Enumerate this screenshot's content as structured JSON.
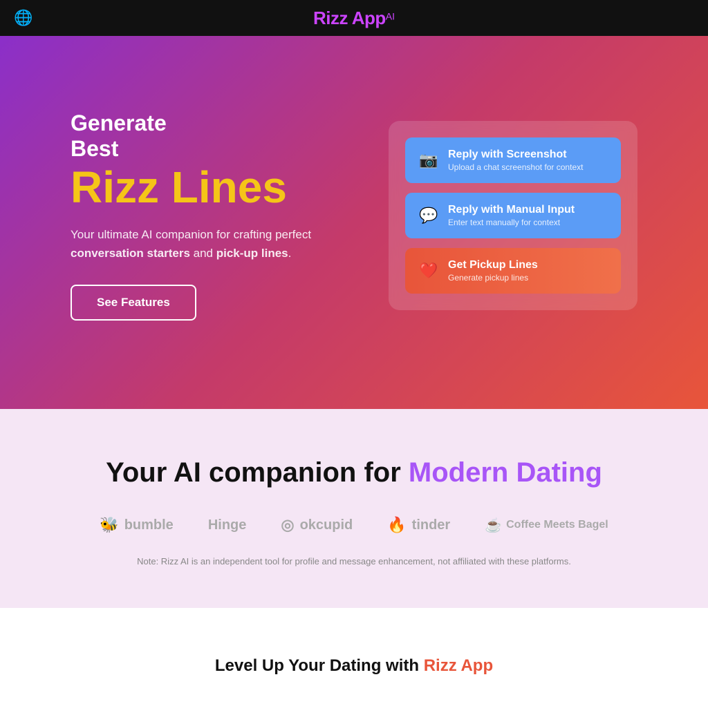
{
  "nav": {
    "title": "Rizz App",
    "title_ai": "AI",
    "globe_icon": "🌐"
  },
  "hero": {
    "headline_line1": "Generate",
    "headline_line2": "Best",
    "headline_rizz": "Rizz Lines",
    "subtext_normal": "Your ultimate AI companion for crafting perfect ",
    "subtext_bold1": "conversation starters",
    "subtext_and": " and ",
    "subtext_bold2": "pick-up lines",
    "subtext_period": ".",
    "see_features_label": "See Features"
  },
  "action_card": {
    "screenshot_btn": {
      "title": "Reply with Screenshot",
      "subtitle": "Upload a chat screenshot for context",
      "icon": "📷"
    },
    "manual_btn": {
      "title": "Reply with Manual Input",
      "subtitle": "Enter text manually for context",
      "icon": "💬"
    },
    "pickup_btn": {
      "title": "Get Pickup Lines",
      "subtitle": "Generate pickup lines",
      "icon": "❤️"
    }
  },
  "companion_section": {
    "title_normal": "Your AI companion for ",
    "title_colored": "Modern Dating",
    "platforms": [
      {
        "name": "bumble",
        "icon": "🐝"
      },
      {
        "name": "Hinge",
        "icon": "H"
      },
      {
        "name": "okcupid",
        "icon": "◎"
      },
      {
        "name": "tinder",
        "icon": "🔥"
      },
      {
        "name": "Coffee Meets Bagel",
        "icon": "☕"
      }
    ],
    "disclaimer": "Note: Rizz AI is an independent tool for profile and message enhancement, not affiliated with these platforms."
  },
  "levelup_section": {
    "title_normal": "Level Up Your Dating with ",
    "title_colored": "Rizz App"
  }
}
